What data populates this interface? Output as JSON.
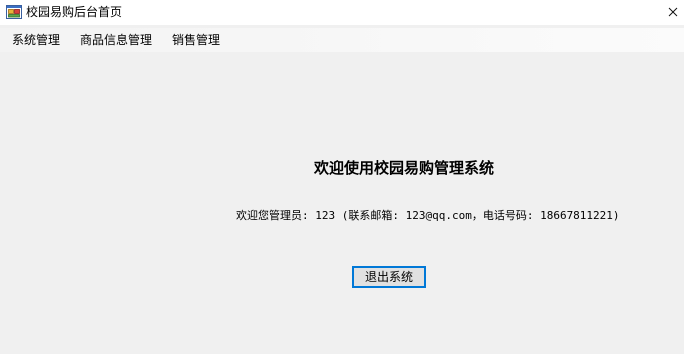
{
  "window": {
    "title": "校园易购后台首页",
    "app_icon": "windows-form-icon",
    "close_icon": "close-icon"
  },
  "menu": {
    "items": [
      {
        "label": "系统管理"
      },
      {
        "label": "商品信息管理"
      },
      {
        "label": "销售管理"
      }
    ]
  },
  "main": {
    "heading": "欢迎使用校园易购管理系统",
    "welcome_text": "欢迎您管理员: 123 (联系邮箱: 123@qq.com，电话号码: 18667811221)",
    "exit_button_label": "退出系统"
  },
  "colors": {
    "background": "#f0f0f0",
    "titlebar": "#ffffff",
    "button_face": "#e1e1e1",
    "focus_border": "#0078d7"
  }
}
